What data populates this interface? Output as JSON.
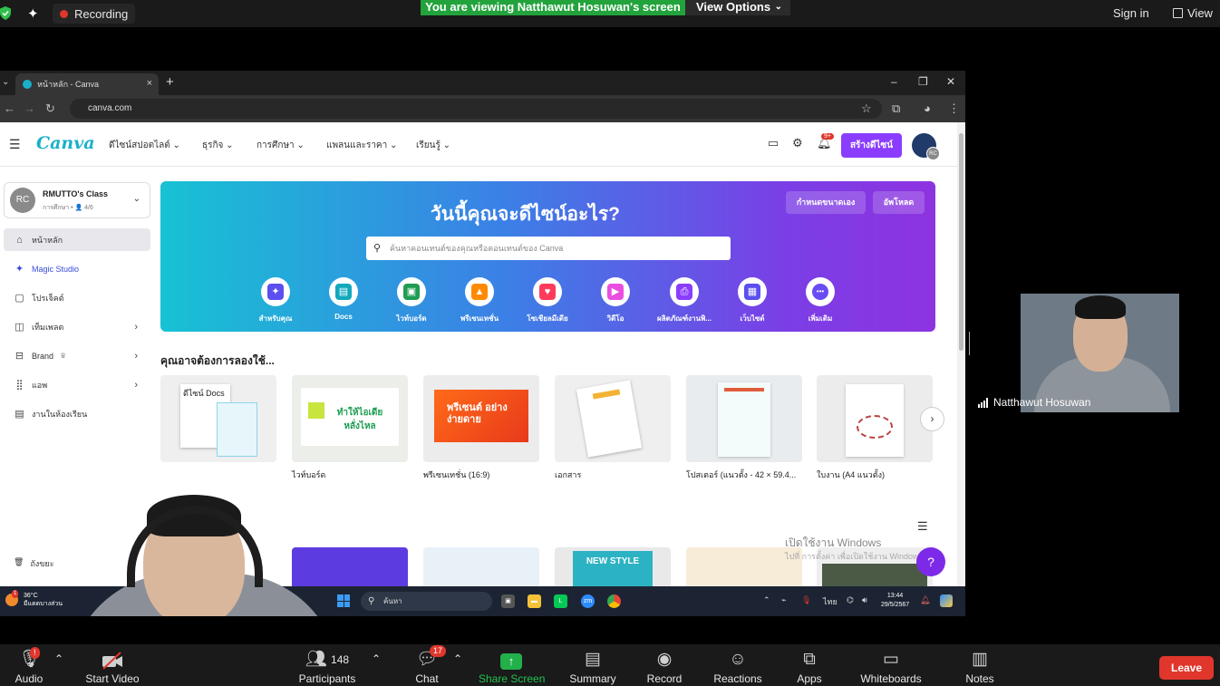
{
  "zoom_top": {
    "recording_label": "Recording",
    "viewing_banner": "You are viewing Natthawut Hosuwan's screen",
    "view_options": "View Options",
    "sign_in": "Sign in",
    "view": "View"
  },
  "browser": {
    "tab_title": "หน้าหลัก - Canva",
    "url": "canva.com"
  },
  "canva": {
    "logo": "Canva",
    "menu": [
      "ดีไซน์สปอตไลต์",
      "ธุรกิจ",
      "การศึกษา",
      "แพลนและราคา",
      "เรียนรู้"
    ],
    "notif_badge": "9+",
    "create_button": "สร้างดีไซน์",
    "avatar_initials": "RC",
    "team": {
      "initials": "RC",
      "name": "RMUTTO's Class",
      "sub": "การศึกษา • 👤 4/6"
    },
    "sidebar": [
      {
        "label": "หน้าหลัก",
        "icon": "home-icon"
      },
      {
        "label": "Magic Studio",
        "icon": "sparkle-icon"
      },
      {
        "label": "โปรเจ็คต์",
        "icon": "folder-icon"
      },
      {
        "label": "เท็มเพลต",
        "icon": "template-icon"
      },
      {
        "label": "Brand",
        "icon": "crown-icon"
      },
      {
        "label": "แอพ",
        "icon": "apps-icon"
      },
      {
        "label": "งานในห้องเรียน",
        "icon": "classwork-icon"
      }
    ],
    "trash_label": "ถังขยะ",
    "hero": {
      "title": "วันนี้คุณจะดีไซน์อะไร?",
      "custom_size": "กำหนดขนาดเอง",
      "upload": "อัพโหลด",
      "search_placeholder": "ค้นหาคอนเทนต์ของคุณหรือคอนเทนต์ของ Canva",
      "categories": [
        {
          "label": "สำหรับคุณ",
          "color": "#5b4ff0",
          "glyph": "✦"
        },
        {
          "label": "Docs",
          "color": "#11a9bd",
          "glyph": "▤"
        },
        {
          "label": "ไวท์บอร์ด",
          "color": "#1e9d53",
          "glyph": "▣"
        },
        {
          "label": "พรีเซนเทชั่น",
          "color": "#ff8a00",
          "glyph": "▲"
        },
        {
          "label": "โซเชียลมีเดีย",
          "color": "#ff3b5c",
          "glyph": "♥"
        },
        {
          "label": "วิดีโอ",
          "color": "#e94ee0",
          "glyph": "▶"
        },
        {
          "label": "ผลิตภัณฑ์งานพิ...",
          "color": "#8b3dff",
          "glyph": "⎙"
        },
        {
          "label": "เว็บไซต์",
          "color": "#5b4ff0",
          "glyph": "▦"
        },
        {
          "label": "เพิ่มเติม",
          "color": "#6a4cf5",
          "glyph": "•••"
        }
      ]
    },
    "section_title": "คุณอาจต้องการลองใช้...",
    "cards": [
      {
        "label": ""
      },
      {
        "label": "ไวท์บอร์ด"
      },
      {
        "label": "พรีเซนเทชั่น (16:9)"
      },
      {
        "label": "เอกสาร"
      },
      {
        "label": "โปสเตอร์ (แนวตั้ง - 42 × 59.4..."
      },
      {
        "label": "ใบงาน (A4 แนวตั้ง)"
      }
    ],
    "card_texts": {
      "docs": "ดีไซน์ Docs",
      "whiteboard": "ทำให้ไอเดีย หลั่งไหล",
      "presentation": "พรีเซนต์ อย่างง่ายดาย",
      "new_style": "NEW STYLE"
    },
    "windows_activate": "เปิดใช้งาน Windows",
    "windows_activate_sub": "ไปที่ การตั้งค่า เพื่อเปิดใช้งาน Windows",
    "help": "?"
  },
  "taskbar": {
    "weather_temp": "36°C",
    "weather_desc": "มีแดดบางส่วน",
    "weather_badge": "1",
    "search": "ค้นหา",
    "lang": "ไทย",
    "time": "13:44",
    "date": "29/5/2567"
  },
  "thumbnail": {
    "name": "Natthawut Hosuwan"
  },
  "zoom_bottom": {
    "audio": "Audio",
    "audio_badge": "!",
    "start_video": "Start Video",
    "participants": "Participants",
    "participants_count": "148",
    "chat": "Chat",
    "chat_badge": "17",
    "share_screen": "Share Screen",
    "summary": "Summary",
    "record": "Record",
    "reactions": "Reactions",
    "apps": "Apps",
    "whiteboards": "Whiteboards",
    "notes": "Notes",
    "leave": "Leave"
  }
}
